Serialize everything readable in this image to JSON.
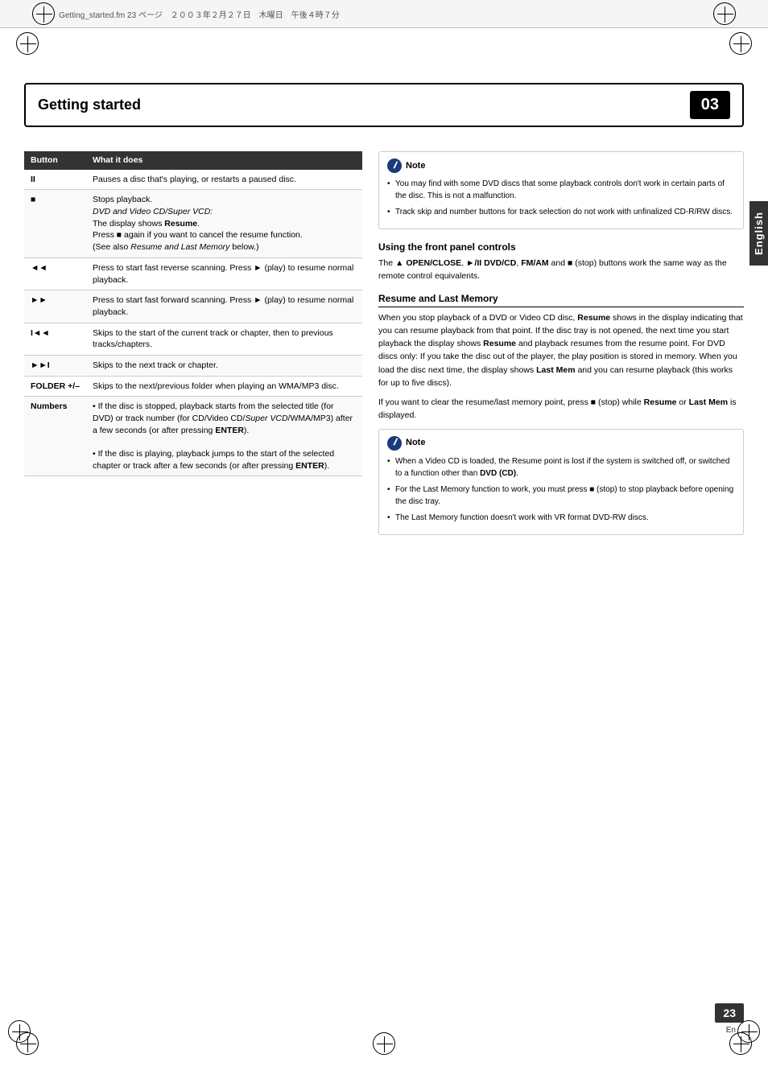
{
  "page": {
    "file_info": "Getting_started.fm  23 ページ　２００３年２月２７日　木曜日　午後４時７分",
    "chapter": "03",
    "section_title": "Getting started",
    "page_number": "23",
    "page_en": "En"
  },
  "table": {
    "col1_header": "Button",
    "col2_header": "What it does",
    "rows": [
      {
        "button": "II",
        "description": "Pauses a disc that's playing, or restarts a paused disc."
      },
      {
        "button": "■",
        "description": "Stops playback.\nDVD and Video CD/Super VCD:\nThe display shows Resume.\nPress ■ again if you want to cancel the resume function.\n(See also Resume and Last Memory below.)"
      },
      {
        "button": "◄◄",
        "description": "Press to start fast reverse scanning. Press ► (play) to resume normal playback."
      },
      {
        "button": "►►",
        "description": "Press to start fast forward scanning. Press ► (play) to resume normal playback."
      },
      {
        "button": "I◄◄",
        "description": "Skips to the start of the current track or chapter, then to previous tracks/chapters."
      },
      {
        "button": "►►I",
        "description": "Skips to the next track or chapter."
      },
      {
        "button": "FOLDER +/–",
        "description": "Skips to the next/previous folder when playing an WMA/MP3 disc."
      },
      {
        "button": "Numbers",
        "description": "• If the disc is stopped, playback starts from the selected title (for DVD) or track number (for CD/Video CD/Super VCD/WMA/MP3) after a few seconds (or after pressing ENTER).\n• If the disc is playing, playback jumps to the start of the selected chapter or track after a few seconds (or after pressing ENTER)."
      }
    ]
  },
  "note1": {
    "header": "Note",
    "items": [
      "You may find with some DVD discs that some playback controls don't work in certain parts of the disc. This is not a malfunction.",
      "Track skip and number buttons for track selection do not work with unfinalized CD-R/RW discs."
    ]
  },
  "front_panel": {
    "heading": "Using the front panel controls",
    "body": "The ▲ OPEN/CLOSE, ►/II DVD/CD, FM/AM and ■ (stop) buttons work the same way as the remote control equivalents."
  },
  "resume_section": {
    "heading": "Resume and Last Memory",
    "body1": "When you stop playback of a DVD or Video CD disc, Resume shows in the display indicating that you can resume playback from that point. If the disc tray is not opened, the next time you start playback the display shows Resume and playback resumes from the resume point. For DVD discs only: If you take the disc out of the player, the play position is stored in memory. When you load the disc next time, the display shows Last Mem and you can resume playback (this works for up to five discs).",
    "body2": "If you want to clear the resume/last memory point, press ■ (stop) while Resume or Last Mem is displayed."
  },
  "note2": {
    "header": "Note",
    "items": [
      "When a Video CD is loaded, the Resume point is lost if the system is switched off, or switched to a function other than DVD (CD).",
      "For the Last Memory function to work, you must press ■ (stop) to stop playback before opening the disc tray.",
      "The Last Memory function doesn't work with VR format DVD-RW discs."
    ]
  },
  "english_tag": "English"
}
